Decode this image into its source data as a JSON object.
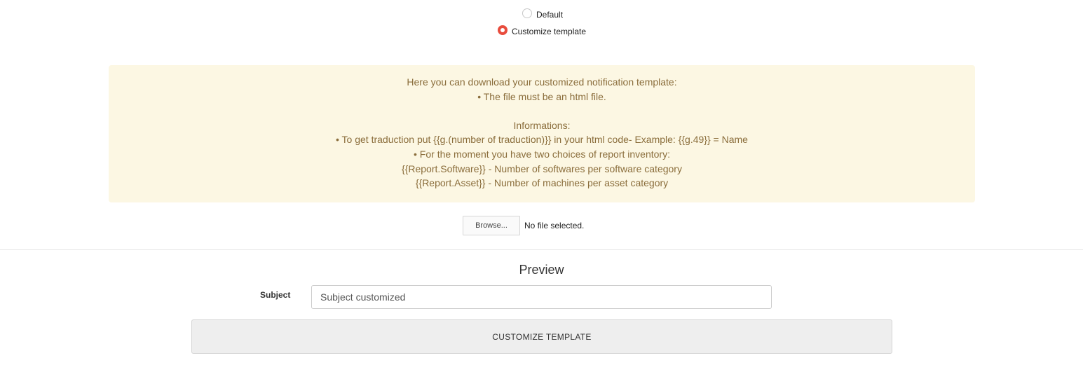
{
  "template_mode": {
    "options": [
      {
        "label": "Default",
        "selected": false
      },
      {
        "label": "Customize template",
        "selected": true
      }
    ]
  },
  "info": {
    "line1": "Here you can download your customized notification template:",
    "line2": "• The file must be an html file.",
    "line3": "Informations:",
    "line4": "• To get traduction put {{g.(number of traduction)}} in your html code- Example: {{g.49}} = Name",
    "line5": "• For the moment you have two choices of report inventory:",
    "line6": "{{Report.Software}} - Number of softwares per software category",
    "line7": "{{Report.Asset}} - Number of machines per asset category"
  },
  "file_upload": {
    "browse_label": "Browse...",
    "status": "No file selected."
  },
  "preview": {
    "title": "Preview",
    "subject_label": "Subject",
    "subject_value": "Subject customized"
  },
  "actions": {
    "customize_label": "CUSTOMIZE TEMPLATE"
  },
  "colors": {
    "accent": "#e84c3d",
    "info_background": "#fcf7e3",
    "info_text": "#8a6d3b"
  }
}
